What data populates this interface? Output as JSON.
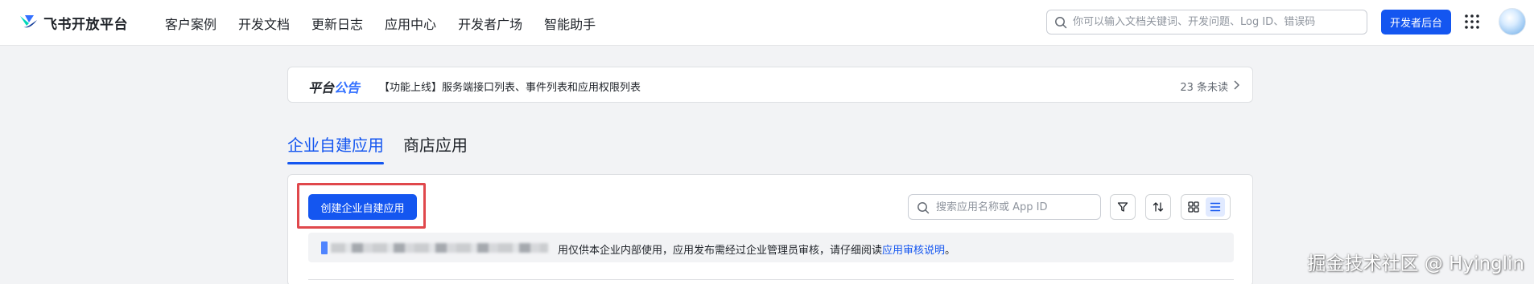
{
  "brand": {
    "name": "飞书开放平台",
    "logo_icon": "feishu-logo-icon"
  },
  "nav": {
    "items": [
      {
        "label": "客户案例"
      },
      {
        "label": "开发文档"
      },
      {
        "label": "更新日志"
      },
      {
        "label": "应用中心"
      },
      {
        "label": "开发者广场"
      },
      {
        "label": "智能助手"
      }
    ],
    "search_placeholder": "你可以输入文档关键词、开发问题、Log ID、错误码",
    "dev_console_label": "开发者后台",
    "apps_icon": "grid-icon",
    "avatar_icon": "avatar"
  },
  "announcement": {
    "title_prefix": "平台",
    "title_accent": "公告",
    "text": "【功能上线】服务端接口列表、事件列表和应用权限列表",
    "unread": "23 条未读"
  },
  "tabs": [
    {
      "label": "企业自建应用",
      "active": true
    },
    {
      "label": "商店应用",
      "active": false
    }
  ],
  "main": {
    "create_button": "创建企业自建应用",
    "search_placeholder": "搜索应用名称或 App ID",
    "notice_text": "用仅供本企业内部使用，应用发布需经过企业管理员审核，请仔细阅读",
    "notice_link": "应用审核说明",
    "notice_end": "。"
  },
  "watermark": "掘金技术社区 @ Hyinglin",
  "colors": {
    "primary": "#1456f0",
    "accent": "#3370ff",
    "highlight": "#e0484c",
    "background": "#f2f3f5"
  }
}
